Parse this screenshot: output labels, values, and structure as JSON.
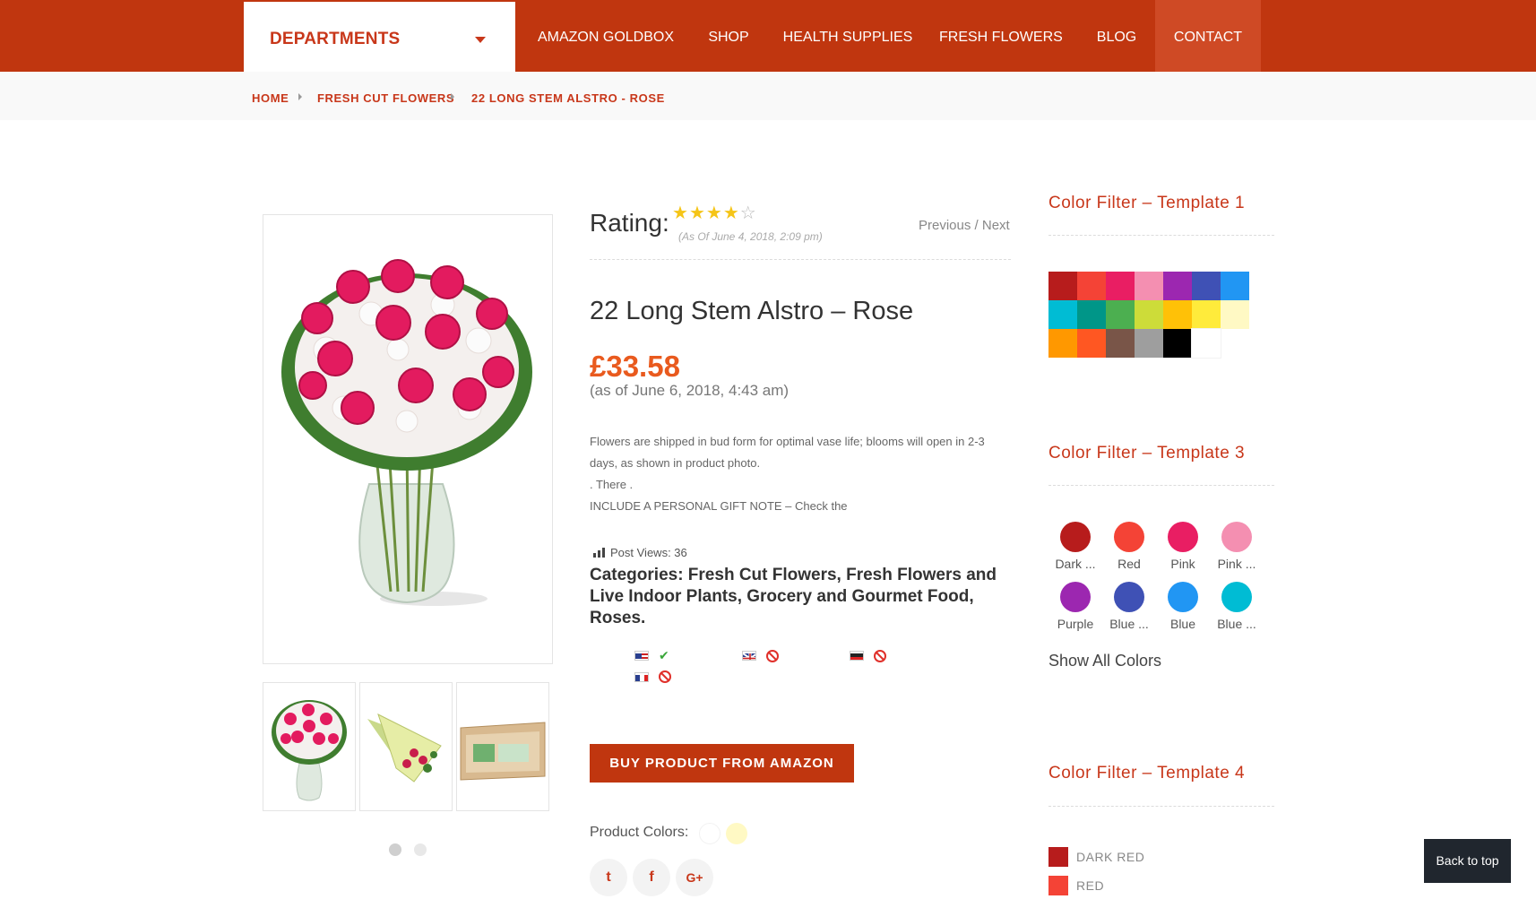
{
  "nav": {
    "departments": "DEPARTMENTS",
    "items": [
      "AMAZON GOLDBOX",
      "SHOP",
      "HEALTH SUPPLIES",
      "FRESH FLOWERS",
      "BLOG",
      "CONTACT"
    ]
  },
  "breadcrumb": [
    "HOME",
    "FRESH CUT FLOWERS",
    "22 LONG STEM ALSTRO - ROSE"
  ],
  "product": {
    "rating_label": "Rating:",
    "rating_stars": 4,
    "rating_max": 5,
    "rating_date": "(As Of June 4, 2018, 2:09 pm)",
    "prev_next": "Previous / Next",
    "title": "22 Long Stem Alstro – Rose",
    "price": "£33.58",
    "price_date": "(as of June 6, 2018, 4:43 am)",
    "description": [
      "Flowers are shipped in bud form for optimal vase life; blooms will open in 2-3",
      "days, as shown in product photo.",
      ". There .",
      "INCLUDE A PERSONAL GIFT NOTE – Check the"
    ],
    "post_views": "Post Views: 36",
    "categories": "Categories: Fresh Cut Flowers, Fresh Flowers and Live Indoor Plants, Grocery and Gourmet Food, Roses.",
    "buy_button": "BUY PRODUCT FROM AMAZON",
    "product_colors_label": "Product Colors:",
    "product_colors": [
      "#ffffff",
      "#fff9c4"
    ],
    "social": [
      "t",
      "f",
      "G+"
    ]
  },
  "availability": [
    {
      "flag": "us-flag-icon",
      "status": "available"
    },
    {
      "flag": "uk-flag-icon",
      "status": "unavailable"
    },
    {
      "flag": "de-flag-icon",
      "status": "unavailable"
    },
    {
      "flag": "fr-flag-icon",
      "status": "unavailable"
    }
  ],
  "sidebar": {
    "template1_title": "Color Filter – Template 1",
    "template1_colors": [
      "#b71c1c",
      "#f44336",
      "#e91e63",
      "#f48fb1",
      "#9c27b0",
      "#3f51b5",
      "#2196f3",
      "#00bcd4",
      "#009688",
      "#4caf50",
      "#cddc39",
      "#ffc107",
      "#ffeb3b",
      "#fff9c4",
      "#ff9800",
      "#ff5722",
      "#795548",
      "#9e9e9e",
      "#000000",
      "#ffffff"
    ],
    "template3_title": "Color Filter – Template 3",
    "template3_colors": [
      {
        "name": "Dark ...",
        "color": "#b71c1c"
      },
      {
        "name": "Red",
        "color": "#f44336"
      },
      {
        "name": "Pink",
        "color": "#e91e63"
      },
      {
        "name": "Pink ...",
        "color": "#f48fb1"
      },
      {
        "name": "Purple",
        "color": "#9c27b0"
      },
      {
        "name": "Blue ...",
        "color": "#3f51b5"
      },
      {
        "name": "Blue",
        "color": "#2196f3"
      },
      {
        "name": "Blue ...",
        "color": "#00bcd4"
      }
    ],
    "show_all": "Show All Colors",
    "template4_title": "Color Filter – Template 4",
    "template4_colors": [
      {
        "name": "DARK RED",
        "color": "#b71c1c"
      },
      {
        "name": "RED",
        "color": "#f44336"
      }
    ]
  },
  "back_to_top": "Back to top",
  "colors": {
    "brand": "#c0360f",
    "accent_text": "#c8371a",
    "price": "#e95a1e"
  }
}
